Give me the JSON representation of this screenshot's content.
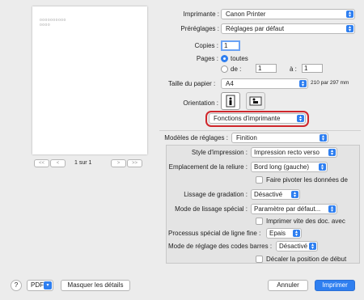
{
  "preview": {
    "page_text_line1": "oooooooooo",
    "page_text_line2": "oooo",
    "page_indicator": "1 sur 1",
    "nav_first": "<<",
    "nav_prev": "<",
    "nav_next": ">",
    "nav_last": ">>"
  },
  "printer": {
    "label": "Imprimante :",
    "value": "Canon Printer"
  },
  "presets": {
    "label": "Préréglages :",
    "value": "Réglages par défaut"
  },
  "copies": {
    "label": "Copies :",
    "value": "1"
  },
  "pages": {
    "label": "Pages :",
    "all_label": "toutes",
    "from_label": "de :",
    "from_value": "1",
    "to_label": "à :",
    "to_value": "1",
    "selected": "all"
  },
  "paper_size": {
    "label": "Taille du papier :",
    "value": "A4",
    "dimensions": "210 par 297 mm"
  },
  "orientation": {
    "label": "Orientation :",
    "selected": "portrait"
  },
  "section_menu": {
    "value": "Fonctions d'imprimante",
    "highlight_color": "#d0262b"
  },
  "feature_sets": {
    "label": "Modèles de réglages :",
    "value": "Finition"
  },
  "options": {
    "print_style": {
      "label": "Style d'impression :",
      "value": "Impression recto verso"
    },
    "binding_location": {
      "label": "Emplacement de la reliure :",
      "value": "Bord long (gauche)"
    },
    "rotate_data": {
      "label": "Faire pivoter les données de",
      "checked": false
    },
    "gradation_smoothing": {
      "label": "Lissage de gradation :",
      "value": "Désactivé"
    },
    "special_smoothing": {
      "label": "Mode de lissage spécial :",
      "value": "Paramètre par défaut..."
    },
    "print_fast": {
      "label": "Imprimer vite des doc. avec",
      "checked": false
    },
    "thin_line": {
      "label": "Processus spécial de ligne fine :",
      "value": "Epais"
    },
    "barcode_mode": {
      "label": "Mode de réglage des codes barres :",
      "value": "Désactivé"
    },
    "shift_position": {
      "label": "Décaler la position de début",
      "checked": false
    }
  },
  "bottom": {
    "help": "?",
    "pdf": "PDF",
    "show_details": "Masquer les détails",
    "cancel": "Annuler",
    "print": "Imprimer"
  },
  "colors": {
    "accent": "#2f7ff0",
    "background": "#ececec"
  }
}
